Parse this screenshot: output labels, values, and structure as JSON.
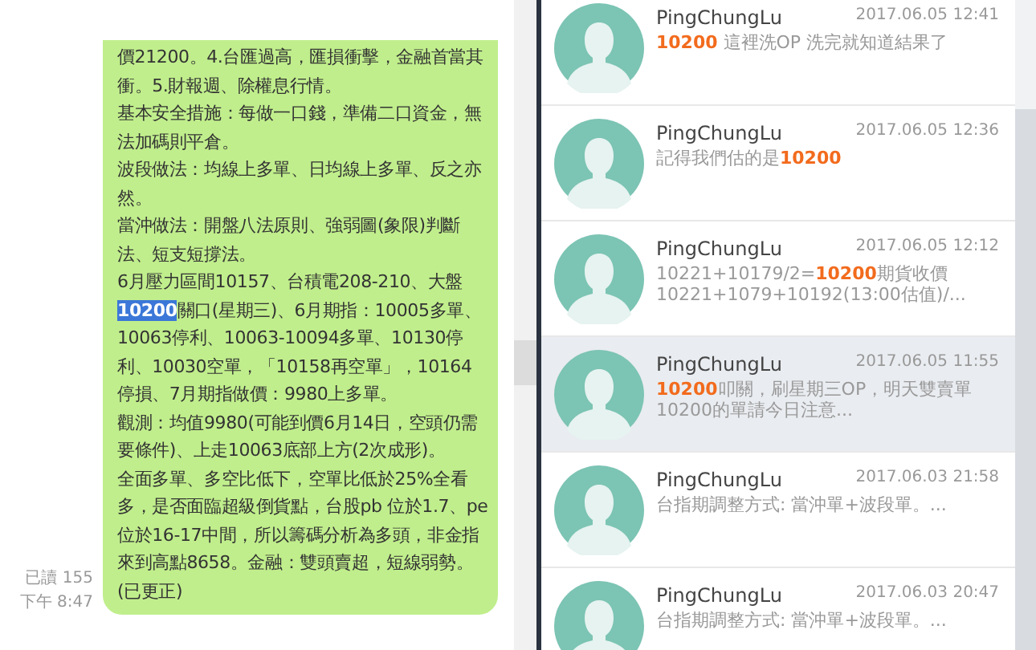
{
  "chat": {
    "bubble": {
      "paragraphs": [
        {
          "segments": [
            {
              "text": "價21200。4.台匯過高，匯損衝擊，金融首當其衝。5.財報週、除權息行情。",
              "highlighted": false
            }
          ]
        },
        {
          "segments": [
            {
              "text": "基本安全措施：每做一口錢，準備二口資金，無法加碼則平倉。",
              "highlighted": false
            }
          ]
        },
        {
          "segments": [
            {
              "text": "波段做法：均線上多單、日均線上多單、反之亦然。",
              "highlighted": false
            }
          ]
        },
        {
          "segments": [
            {
              "text": "當沖做法：開盤八法原則、強弱圖(象限)判斷法、短支短撐法。",
              "highlighted": false
            }
          ]
        },
        {
          "segments": [
            {
              "text": "6月壓力區間10157、台積電208-210、大盤",
              "highlighted": false
            },
            {
              "text": "10200",
              "highlighted": true
            },
            {
              "text": "關口(星期三)、6月期指：10005多單、10063停利、10063-10094多單、10130停利、10030空單，「10158再空單」，10164停損、7月期指做價：9980上多單。",
              "highlighted": false
            }
          ]
        },
        {
          "segments": [
            {
              "text": "觀測：均值9980(可能到價6月14日，空頭仍需要條件)、上走10063底部上方(2次成形)。",
              "highlighted": false
            }
          ]
        },
        {
          "segments": [
            {
              "text": "全面多單、多空比低下，空單比低於25%全看多，是否面臨超級倒貨點，台股pb 位於1.7、pe位於16-17中間，所以籌碼分析為多頭，非金指來到高點8658。金融：雙頭賣超，短線弱勢。(已更正)",
              "highlighted": false
            }
          ]
        }
      ]
    },
    "read_status": "已讀 155",
    "time": "下午 8:47"
  },
  "results": [
    {
      "name": "PingChungLu",
      "date": "2017.06.05 12:41",
      "message": "**10200** 這裡洗OP 洗完就知道結果了",
      "hovered": false
    },
    {
      "name": "PingChungLu",
      "date": "2017.06.05 12:36",
      "message": "記得我們估的是**10200**",
      "hovered": false
    },
    {
      "name": "PingChungLu",
      "date": "2017.06.05 12:12",
      "message": "10221+10179/2=**10200**期貨收價 10221+1079+10192(13:00估值)/...",
      "hovered": false
    },
    {
      "name": "PingChungLu",
      "date": "2017.06.05 11:55",
      "message": "**10200**叩關，刷星期三OP，明天雙賣單10200的單請今日注意...",
      "hovered": true
    },
    {
      "name": "PingChungLu",
      "date": "2017.06.03 21:58",
      "message": "台指期調整方式: 當沖單+波段單。...",
      "hovered": false
    },
    {
      "name": "PingChungLu",
      "date": "2017.06.03 20:47",
      "message": "台指期調整方式: 當沖單+波段單。...",
      "hovered": false
    }
  ]
}
